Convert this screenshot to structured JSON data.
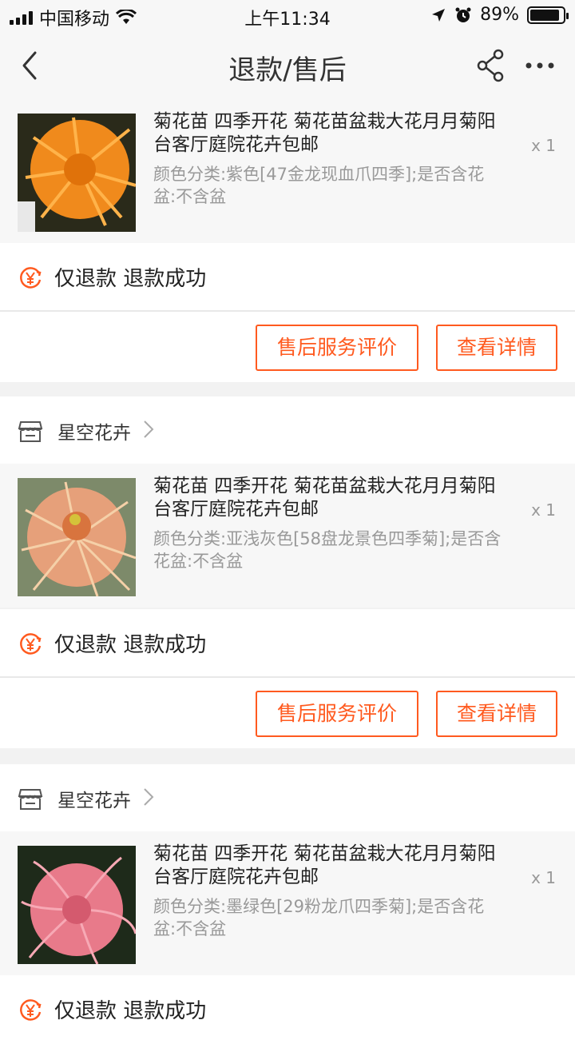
{
  "status_bar": {
    "carrier": "中国移动",
    "time": "上午11:34",
    "battery": "89%"
  },
  "nav": {
    "title": "退款/售后"
  },
  "orders": [
    {
      "product": {
        "title": "菊花苗 四季开花 菊花苗盆栽大花月月菊阳台客厅庭院花卉包邮",
        "spec": "颜色分类:紫色[47金龙现血爪四季];是否含花盆:不含盆",
        "qty": "x 1"
      },
      "refund_type": "仅退款",
      "refund_status": "退款成功",
      "buttons": {
        "review": "售后服务评价",
        "detail": "查看详情"
      }
    },
    {
      "shop_name": "星空花卉",
      "product": {
        "title": "菊花苗 四季开花 菊花苗盆栽大花月月菊阳台客厅庭院花卉包邮",
        "spec": "颜色分类:亚浅灰色[58盘龙景色四季菊];是否含花盆:不含盆",
        "qty": "x 1"
      },
      "refund_type": "仅退款",
      "refund_status": "退款成功",
      "buttons": {
        "review": "售后服务评价",
        "detail": "查看详情"
      }
    },
    {
      "shop_name": "星空花卉",
      "product": {
        "title": "菊花苗 四季开花 菊花苗盆栽大花月月菊阳台客厅庭院花卉包邮",
        "spec": "颜色分类:墨绿色[29粉龙爪四季菊];是否含花盆:不含盆",
        "qty": "x 1"
      },
      "refund_type": "仅退款",
      "refund_status": "退款成功"
    }
  ],
  "icons": {
    "back": "back-arrow-icon",
    "share": "share-icon",
    "more": "more-dots-icon",
    "shop": "shop-icon",
    "refund": "yuan-refund-icon",
    "chevron": "chevron-right-icon"
  },
  "colors": {
    "accent": "#ff5a1f",
    "muted": "#999999"
  }
}
